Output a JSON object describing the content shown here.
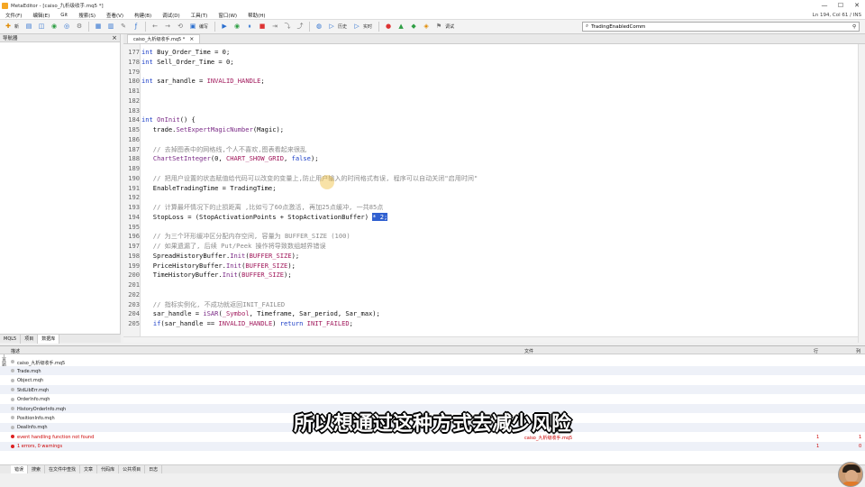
{
  "window": {
    "title": "MetaEditor - [caiso_九析级收手.mq5 *]",
    "controls": [
      "—",
      "☐",
      "✕"
    ]
  },
  "menu": {
    "items": [
      "文件(F)",
      "编辑(E)",
      "Git",
      "搜索(S)",
      "查看(V)",
      "构建(B)",
      "调试(D)",
      "工具(T)",
      "窗口(W)",
      "帮助(H)"
    ],
    "cursor_status": "Ln 194, Col 61 / INS"
  },
  "toolbar": {
    "new_label": "新",
    "compile_label": "编写",
    "history_label": "历史",
    "realtime_label": "实时",
    "debug_label": "调试",
    "search_value": "TradingEnabledComm"
  },
  "navigator": {
    "title": "导航器",
    "tabs": [
      "MQL5",
      "项目",
      "数据库"
    ],
    "active_tab": 2
  },
  "editor": {
    "tab_label": "caiso_九析级收手.mq5 *",
    "lines": [
      {
        "n": "177",
        "text": "int Buy_Order_Time = 0;"
      },
      {
        "n": "178",
        "text": "int Sell_Order_Time = 0;"
      },
      {
        "n": "179",
        "text": ""
      },
      {
        "n": "180",
        "text": "int sar_handle = INVALID_HANDLE;"
      },
      {
        "n": "181",
        "text": ""
      },
      {
        "n": "182",
        "text": ""
      },
      {
        "n": "183",
        "text": ""
      },
      {
        "n": "184",
        "text": "int OnInit() {"
      },
      {
        "n": "185",
        "text": "   trade.SetExpertMagicNumber(Magic);"
      },
      {
        "n": "186",
        "text": ""
      },
      {
        "n": "187",
        "text": "   // 去掉图表中的网格线,个人不喜欢,图表看起来很乱"
      },
      {
        "n": "188",
        "text": "   ChartSetInteger(0, CHART_SHOW_GRID, false);"
      },
      {
        "n": "189",
        "text": ""
      },
      {
        "n": "190",
        "text": "   // 把用户设置的状态赋值给代码可以改变的变量上,防止用户输入的时间格式有误, 程序可以自动关闭\"启用时间\""
      },
      {
        "n": "191",
        "text": "   EnableTradingTime = TradingTime;"
      },
      {
        "n": "192",
        "text": ""
      },
      {
        "n": "193",
        "text": "   // 计算最坏情况下的止损距离 ,比如亏了60点激活, 再加25点缓冲, 一共85点"
      },
      {
        "n": "194",
        "text": "   StopLoss = (StopActivationPoints + StopActivationBuffer) * 2;"
      },
      {
        "n": "195",
        "text": ""
      },
      {
        "n": "196",
        "text": "   // 为三个环形缓冲区分配内存空间, 容量为 BUFFER_SIZE (100)"
      },
      {
        "n": "197",
        "text": "   // 如果遗漏了, 后续 Put/Peek 操作将导致数组越界错误"
      },
      {
        "n": "198",
        "text": "   SpreadHistoryBuffer.Init(BUFFER_SIZE);"
      },
      {
        "n": "199",
        "text": "   PriceHistoryBuffer.Init(BUFFER_SIZE);"
      },
      {
        "n": "200",
        "text": "   TimeHistoryBuffer.Init(BUFFER_SIZE);"
      },
      {
        "n": "201",
        "text": ""
      },
      {
        "n": "202",
        "text": ""
      },
      {
        "n": "203",
        "text": "   // 指标实例化, 不成功就返回INIT_FAILED"
      },
      {
        "n": "204",
        "text": "   sar_handle = iSAR(_Symbol, Timeframe, Sar_period, Sar_max);"
      },
      {
        "n": "205",
        "text": "   if(sar_handle == INVALID_HANDLE) return INIT_FAILED;"
      }
    ]
  },
  "errors": {
    "headers": {
      "description": "描述",
      "file": "文件",
      "line": "行",
      "column": "列"
    },
    "rows": [
      {
        "desc": "caiso_九析级收手.mq5",
        "file": "",
        "line": "",
        "col": "",
        "type": "file"
      },
      {
        "desc": "Trade.mqh",
        "file": "",
        "line": "",
        "col": "",
        "type": "file"
      },
      {
        "desc": "Object.mqh",
        "file": "",
        "line": "",
        "col": "",
        "type": "file"
      },
      {
        "desc": "StdLibErr.mqh",
        "file": "",
        "line": "",
        "col": "",
        "type": "file"
      },
      {
        "desc": "OrderInfo.mqh",
        "file": "",
        "line": "",
        "col": "",
        "type": "file"
      },
      {
        "desc": "HistoryOrderInfo.mqh",
        "file": "",
        "line": "",
        "col": "",
        "type": "file"
      },
      {
        "desc": "PositionInfo.mqh",
        "file": "",
        "line": "",
        "col": "",
        "type": "file"
      },
      {
        "desc": "DealInfo.mqh",
        "file": "",
        "line": "",
        "col": "",
        "type": "file"
      },
      {
        "desc": "event handling function not found",
        "file": "caiso_九析级收手.mq5",
        "line": "1",
        "col": "1",
        "type": "error"
      },
      {
        "desc": "1 errors, 0 warnings",
        "file": "",
        "line": "1",
        "col": "0",
        "type": "summary"
      }
    ],
    "tabs": [
      "错误",
      "搜索",
      "在文件中查找",
      "文章",
      "代码库",
      "公共项目",
      "日志"
    ],
    "active_tab": 0,
    "toolbox_label": "工具箱"
  },
  "subtitle": "所以想通过这种方式去减少风险",
  "colors": {
    "keyword": "#1d3fc7",
    "function": "#7a2a86",
    "constant": "#a0185b",
    "comment": "#8c8c8c",
    "selection": "#2f5fd0",
    "error": "#cc0000"
  }
}
